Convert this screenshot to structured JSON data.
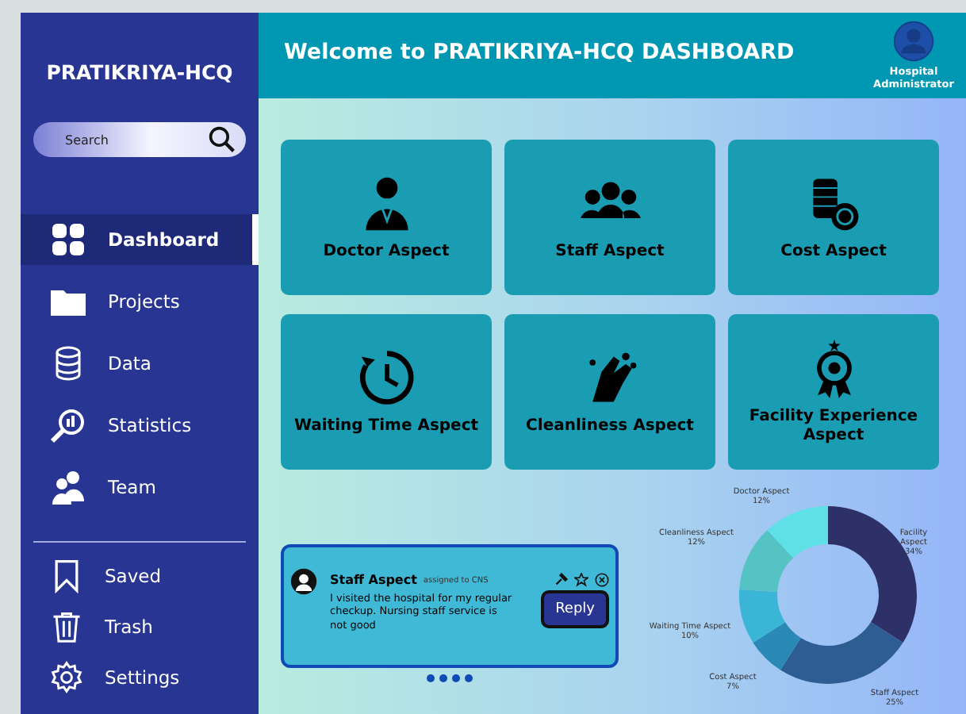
{
  "sidebar": {
    "title": "PRATIKRIYA-HCQ",
    "search": {
      "placeholder": "Search"
    },
    "items": [
      {
        "label": "Dashboard",
        "selected": true
      },
      {
        "label": "Projects",
        "selected": false
      },
      {
        "label": "Data",
        "selected": false
      },
      {
        "label": "Statistics",
        "selected": false
      },
      {
        "label": "Team",
        "selected": false
      }
    ],
    "bottom_items": [
      {
        "label": "Saved"
      },
      {
        "label": "Trash"
      },
      {
        "label": "Settings"
      }
    ]
  },
  "header": {
    "title": "Welcome to PRATIKRIYA-HCQ DASHBOARD",
    "user": "Hospital Administrator"
  },
  "aspects": [
    {
      "label": "Doctor Aspect"
    },
    {
      "label": "Staff Aspect"
    },
    {
      "label": "Cost Aspect"
    },
    {
      "label": "Waiting Time Aspect"
    },
    {
      "label": "Cleanliness Aspect"
    },
    {
      "label": "Facility Experience Aspect"
    }
  ],
  "feedback": {
    "title": "Staff Aspect",
    "assignment": "assigned to CNS",
    "message": "I visited the hospital for my regular checkup. Nursing staff service is not good",
    "reply": "Reply"
  },
  "chart_data": {
    "type": "donut",
    "categories": [
      "Facility Aspect",
      "Staff Aspect",
      "Cost Aspect",
      "Waiting Time Aspect",
      "Cleanliness Aspect",
      "Doctor Aspect"
    ],
    "values": [
      34,
      25,
      7,
      10,
      12,
      12
    ],
    "colors": [
      "#2e3168",
      "#2e5d93",
      "#2a8ab5",
      "#3bb5d6",
      "#55c2c3",
      "#5ee0e6"
    ],
    "value_labels": [
      "34%",
      "25%",
      "7%",
      "10%",
      "12%",
      "12%"
    ]
  }
}
